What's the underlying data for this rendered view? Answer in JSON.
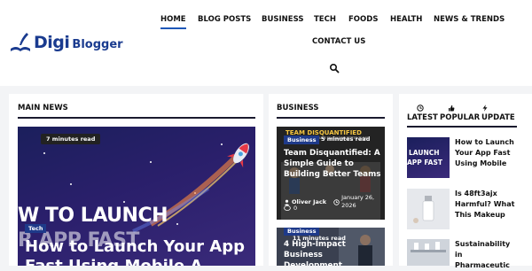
{
  "header": {
    "logo": {
      "part1": "Digi",
      "part2": "Blogger"
    },
    "nav": [
      {
        "label": "HOME",
        "active": true
      },
      {
        "label": "BLOG POSTS",
        "active": false
      },
      {
        "label": "BUSINESS",
        "active": false
      },
      {
        "label": "TECH",
        "active": false
      },
      {
        "label": "FOODS",
        "active": false
      },
      {
        "label": "HEALTH",
        "active": false
      },
      {
        "label": "NEWS & TRENDS",
        "active": false
      },
      {
        "label": "CONTACT US",
        "active": false
      }
    ],
    "search_icon": "search-icon"
  },
  "main_news": {
    "title": "MAIN NEWS",
    "hero": {
      "time": "7 minutes read",
      "category": "Tech",
      "image_text_line1": "W TO LAUNCH",
      "image_text_line2": "R APP FAST",
      "headline": "How to Launch Your App Fast Using Mobile A..."
    }
  },
  "business": {
    "title": "BUSINESS",
    "cards": [
      {
        "image_caption": "TEAM DISQUANTIFIED",
        "image_subcaption": "A SIMPLE GUIDE TO BUILDING BETTER TEAMS",
        "category": "Business",
        "time": "5 minutes read",
        "headline": "Team Disquantified: A Simple Guide to Building Better Teams",
        "author": "Oliver Jack",
        "date": "January 26, 2026",
        "comments": "0"
      },
      {
        "category": "Business",
        "time": "11 minutes read",
        "headline": "4 High-Impact Business Development"
      }
    ]
  },
  "latest": {
    "tabs": [
      "LATEST",
      "POPULAR",
      "UPDATE"
    ],
    "items": [
      {
        "thumb_line1": "LAUNCH",
        "thumb_line2": "APP FAST",
        "title": "How to Launch Your App Fast Using Mobile"
      },
      {
        "title": "Is 48ft3ajx Harmful? What This Makeup"
      },
      {
        "title": "Sustainability in Pharmaceutic"
      }
    ]
  },
  "colors": {
    "accent": "#1e57b8",
    "brand": "#1a3b8f",
    "badge": "#1e3a8a"
  }
}
